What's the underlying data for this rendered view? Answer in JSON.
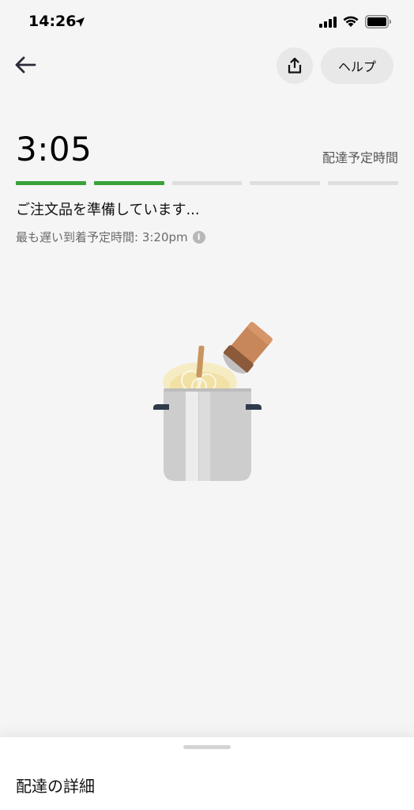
{
  "status_bar": {
    "time": "14:26"
  },
  "header": {
    "help_label": "ヘルプ"
  },
  "eta": {
    "time": "3:05",
    "label": "配達予定時間",
    "progress_segments": [
      true,
      true,
      false,
      false,
      false
    ]
  },
  "order": {
    "status_message": "ご注文品を準備しています...",
    "latest_arrival": "最も遅い到着予定時間: 3:20pm"
  },
  "sheet": {
    "title": "配達の詳細"
  },
  "colors": {
    "accent_green": "#3aa13a",
    "background": "#f5f5f5",
    "button_bg": "#e8e8e8"
  },
  "icons": [
    "location-arrow-icon",
    "signal-icon",
    "wifi-icon",
    "battery-icon",
    "back-arrow-icon",
    "share-icon",
    "info-icon"
  ]
}
